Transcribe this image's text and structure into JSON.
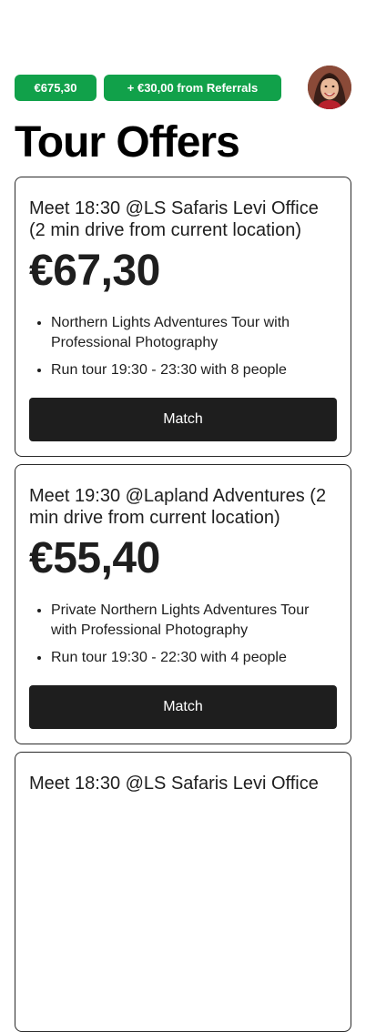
{
  "header": {
    "balance": "€675,30",
    "referral_bonus": "+ €30,00 from Referrals"
  },
  "page": {
    "title": "Tour Offers"
  },
  "offers": [
    {
      "meet": "Meet 18:30 @LS Safaris Levi Office (2 min drive from current location)",
      "price": "€67,30",
      "details": [
        "Northern Lights Adventures Tour with Professional Photography",
        "Run tour 19:30 - 23:30 with 8 people"
      ],
      "action": "Match"
    },
    {
      "meet": "Meet 19:30 @Lapland Adventures (2 min drive from current location)",
      "price": "€55,40",
      "details": [
        "Private Northern Lights Adventures Tour with Professional Photography",
        "Run tour 19:30 - 22:30 with 4 people"
      ],
      "action": "Match"
    },
    {
      "meet": "Meet 18:30 @LS Safaris Levi Office"
    }
  ],
  "icons": {
    "avatar": "user-avatar-photo"
  },
  "colors": {
    "accent_green": "#11a14a",
    "button_dark": "#1e1e1e",
    "text": "#1e1e1e",
    "background": "#ffffff"
  }
}
